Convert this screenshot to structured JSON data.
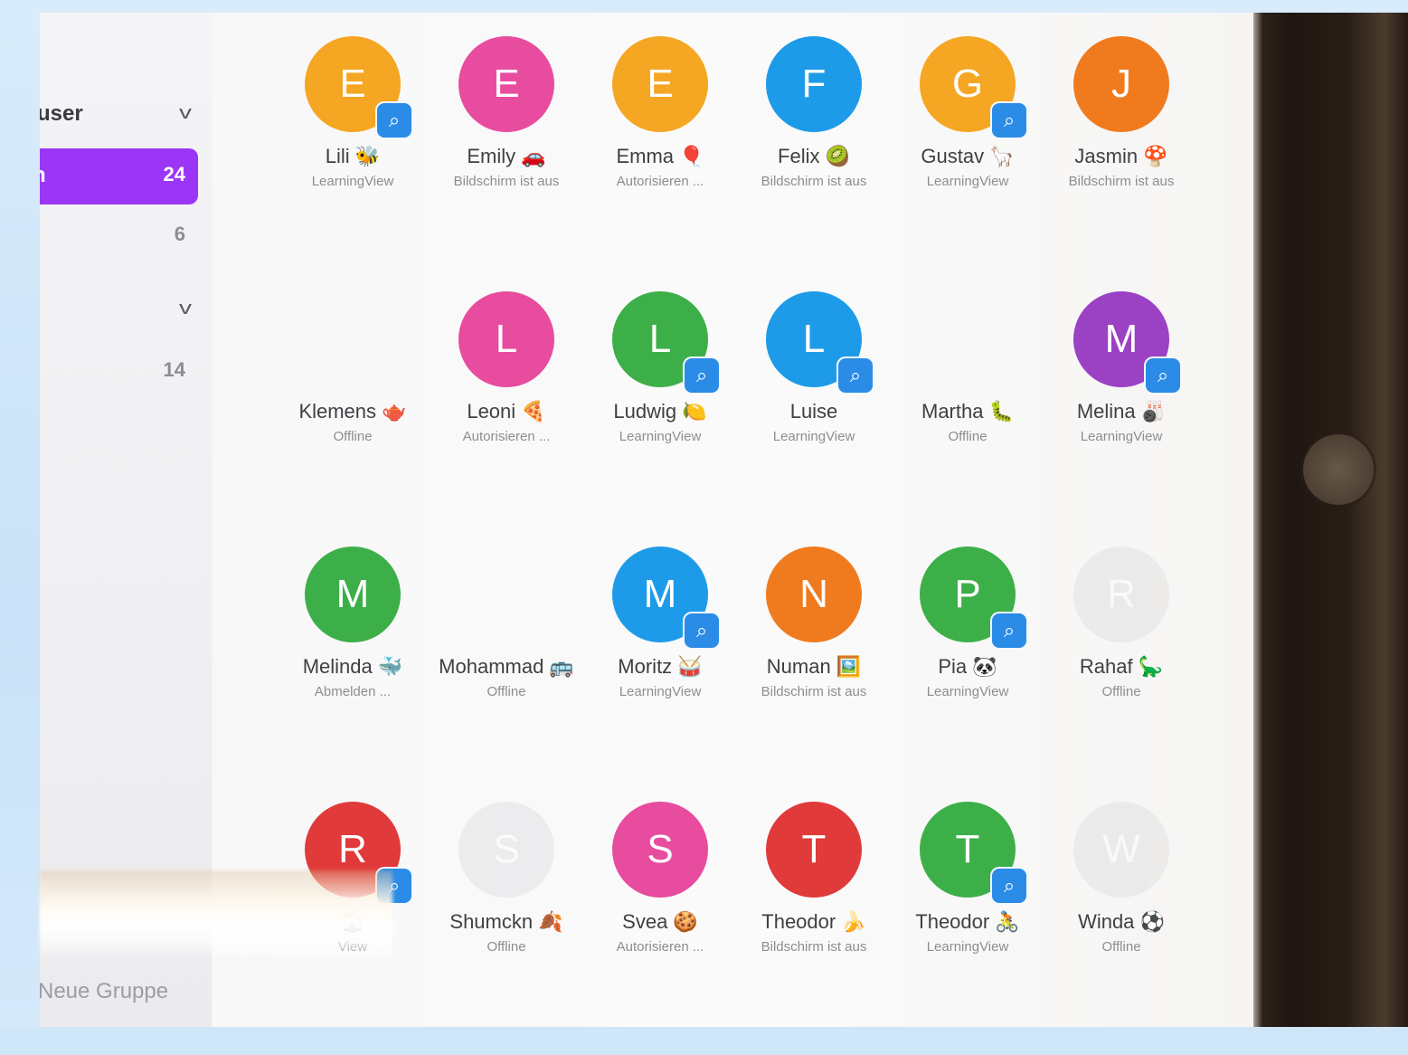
{
  "sidebar": {
    "section1": {
      "label": "user",
      "chevron": "chevron-down-icon"
    },
    "items": [
      {
        "label": "n",
        "count": "24"
      },
      {
        "label": "",
        "count": "6"
      }
    ],
    "section2": {
      "label": "",
      "chevron": "chevron-down-icon"
    },
    "section2_items": [
      {
        "label": "",
        "count": "14"
      }
    ],
    "new_group": "Neue Gruppe"
  },
  "colors": {
    "accent": "#9b36f6",
    "badge": "#2a8ce6",
    "orange": "#f5a623",
    "pink": "#e74c9f",
    "blue": "#1e9be8",
    "green": "#3daf49",
    "red": "#e03a3a",
    "dark_orange": "#f07b1f",
    "purple": "#9b41c4",
    "gray": "#d6d6d8"
  },
  "users": [
    {
      "initial": "E",
      "name": "Lili 🐝",
      "status": "LearningView",
      "color": "#f5a623",
      "viewer": true
    },
    {
      "initial": "E",
      "name": "Emily 🚗",
      "status": "Bildschirm ist aus",
      "color": "#e74c9f",
      "viewer": false
    },
    {
      "initial": "E",
      "name": "Emma 🎈",
      "status": "Autorisieren ...",
      "color": "#f5a623",
      "viewer": false
    },
    {
      "initial": "F",
      "name": "Felix 🥝",
      "status": "Bildschirm ist aus",
      "color": "#1e9be8",
      "viewer": false
    },
    {
      "initial": "G",
      "name": "Gustav 🦙",
      "status": "LearningView",
      "color": "#f5a623",
      "viewer": true
    },
    {
      "initial": "J",
      "name": "Jasmin 🍄",
      "status": "Bildschirm ist aus",
      "color": "#f07b1f",
      "viewer": false
    },
    {
      "initial": "",
      "name": "Klemens 🫖",
      "status": "Offline",
      "color": "",
      "viewer": false
    },
    {
      "initial": "L",
      "name": "Leoni 🍕",
      "status": "Autorisieren ...",
      "color": "#e74c9f",
      "viewer": false
    },
    {
      "initial": "L",
      "name": "Ludwig 🍋",
      "status": "LearningView",
      "color": "#3daf49",
      "viewer": true
    },
    {
      "initial": "L",
      "name": "Luise",
      "status": "LearningView",
      "color": "#1e9be8",
      "viewer": true
    },
    {
      "initial": "",
      "name": "Martha 🐛",
      "status": "Offline",
      "color": "",
      "viewer": false
    },
    {
      "initial": "M",
      "name": "Melina 🎳",
      "status": "LearningView",
      "color": "#9b41c4",
      "viewer": true
    },
    {
      "initial": "M",
      "name": "Melinda 🐳",
      "status": "Abmelden ...",
      "color": "#3daf49",
      "viewer": false
    },
    {
      "initial": "",
      "name": "Mohammad 🚌",
      "status": "Offline",
      "color": "",
      "viewer": false
    },
    {
      "initial": "M",
      "name": "Moritz 🥁",
      "status": "LearningView",
      "color": "#1e9be8",
      "viewer": true
    },
    {
      "initial": "N",
      "name": "Numan 🖼️",
      "status": "Bildschirm ist aus",
      "color": "#f07b1f",
      "viewer": false
    },
    {
      "initial": "P",
      "name": "Pia 🐼",
      "status": "LearningView",
      "color": "#3daf49",
      "viewer": true
    },
    {
      "initial": "R",
      "name": "Rahaf 🦕",
      "status": "Offline",
      "color": "#d6d6d8",
      "viewer": false
    },
    {
      "initial": "R",
      "name": "🏠",
      "status": "View",
      "color": "#e03a3a",
      "viewer": true
    },
    {
      "initial": "S",
      "name": "Shumckn 🍂",
      "status": "Offline",
      "color": "#d6d6d8",
      "viewer": false
    },
    {
      "initial": "S",
      "name": "Svea 🍪",
      "status": "Autorisieren ...",
      "color": "#e74c9f",
      "viewer": false
    },
    {
      "initial": "T",
      "name": "Theodor 🍌",
      "status": "Bildschirm ist aus",
      "color": "#e03a3a",
      "viewer": false
    },
    {
      "initial": "T",
      "name": "Theodor 🚴",
      "status": "LearningView",
      "color": "#3daf49",
      "viewer": true
    },
    {
      "initial": "W",
      "name": "Winda ⚽",
      "status": "Offline",
      "color": "#d6d6d8",
      "viewer": false
    }
  ]
}
